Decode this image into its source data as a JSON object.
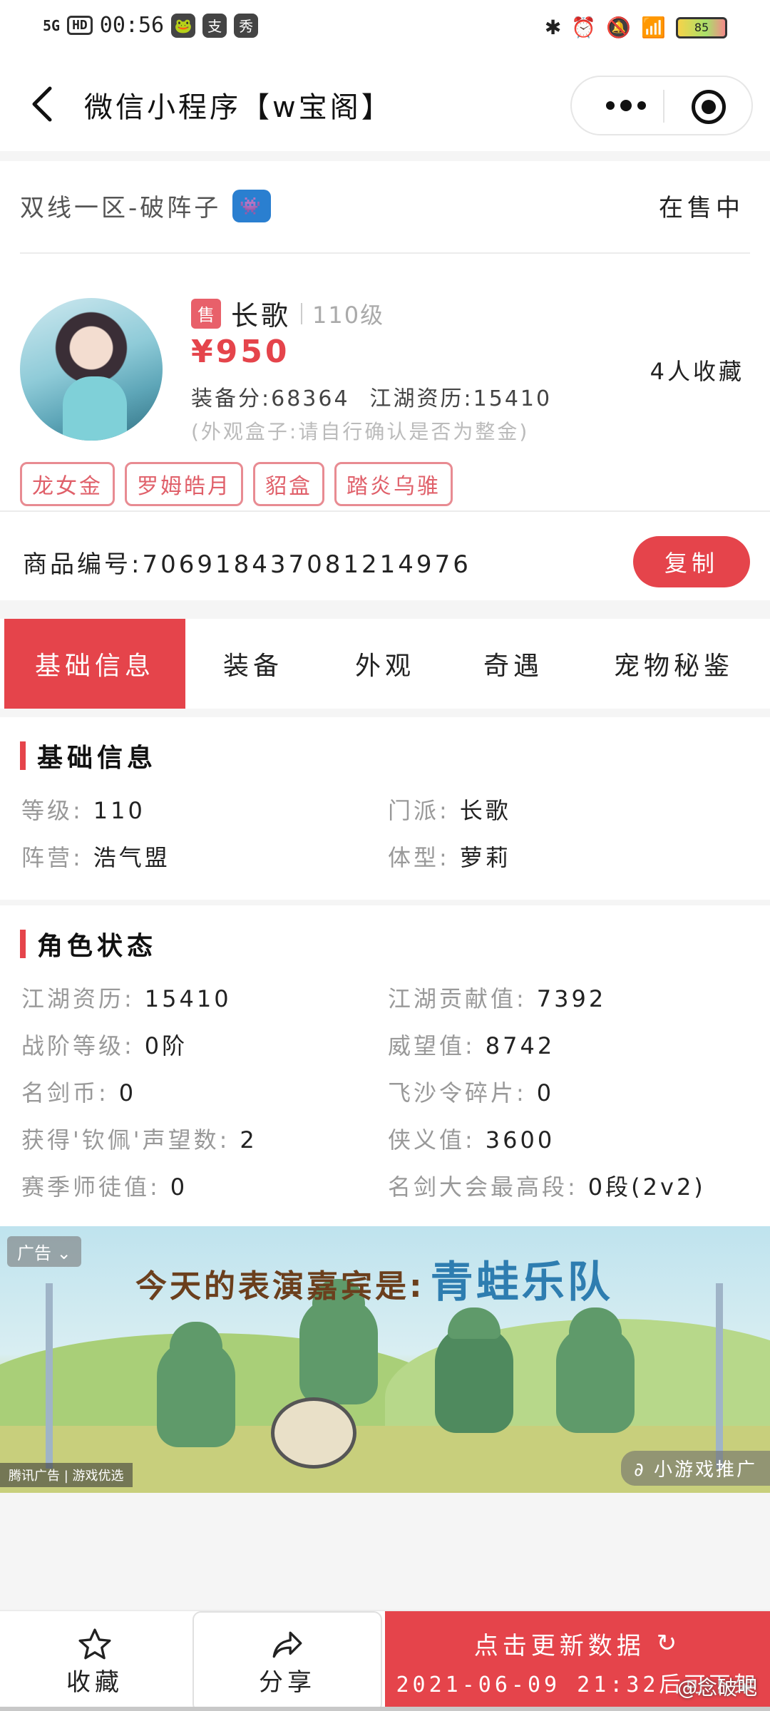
{
  "status_bar": {
    "network": "5G",
    "hd": "HD",
    "time": "00:56",
    "app1": "支",
    "app2": "秀",
    "battery": "85"
  },
  "nav": {
    "title": "微信小程序【w宝阁】"
  },
  "listing": {
    "server": "双线一区-破阵子",
    "sale_status": "在售中",
    "sale_tag": "售",
    "role_name": "长歌",
    "level": "110级",
    "price": "¥950",
    "equip_score": "装备分:68364",
    "jianghu_exp": "江湖资历:15410",
    "note": "(外观盒子:请自行确认是否为整金)",
    "favorites": "4人收藏",
    "tags": [
      "龙女金",
      "罗姆皓月",
      "貂盒",
      "踏炎乌骓"
    ],
    "product_id": "商品编号:7069184370812149​76",
    "copy_label": "复制"
  },
  "tabs": [
    "基础信息",
    "装备",
    "外观",
    "奇遇",
    "宠物秘鉴"
  ],
  "basic_info": {
    "title": "基础信息",
    "items": [
      {
        "k": "等级:",
        "v": "110"
      },
      {
        "k": "门派:",
        "v": "长歌"
      },
      {
        "k": "阵营:",
        "v": "浩气盟"
      },
      {
        "k": "体型:",
        "v": "萝莉"
      }
    ]
  },
  "role_status": {
    "title": "角色状态",
    "items": [
      {
        "k": "江湖资历:",
        "v": "15410"
      },
      {
        "k": "江湖贡献值:",
        "v": "7392"
      },
      {
        "k": "战阶等级:",
        "v": "0阶"
      },
      {
        "k": "威望值:",
        "v": "8742"
      },
      {
        "k": "名剑币:",
        "v": "0"
      },
      {
        "k": "飞沙令碎片:",
        "v": "0"
      },
      {
        "k": "获得'钦佩'声望数:",
        "v": "2"
      },
      {
        "k": "侠义值:",
        "v": "3600"
      },
      {
        "k": "赛季师徒值:",
        "v": "0"
      },
      {
        "k": "名剑大会最高段:",
        "v": "0段(2v2)"
      }
    ]
  },
  "ad": {
    "label": "广告",
    "title_prefix": "今天的表演嘉宾是:",
    "title_highlight": "青蛙乐队",
    "footer_left": "腾讯广告 | 游戏优选",
    "footer_right": "小游戏推广"
  },
  "bottom_bar": {
    "favorite": "收藏",
    "share": "分享",
    "refresh": "点击更新数据",
    "refresh_note": "2021-06-09 21:32后可下架",
    "watermark": "@念破吧"
  },
  "colors": {
    "accent": "#e5444b",
    "tag_border": "#e88b92"
  }
}
